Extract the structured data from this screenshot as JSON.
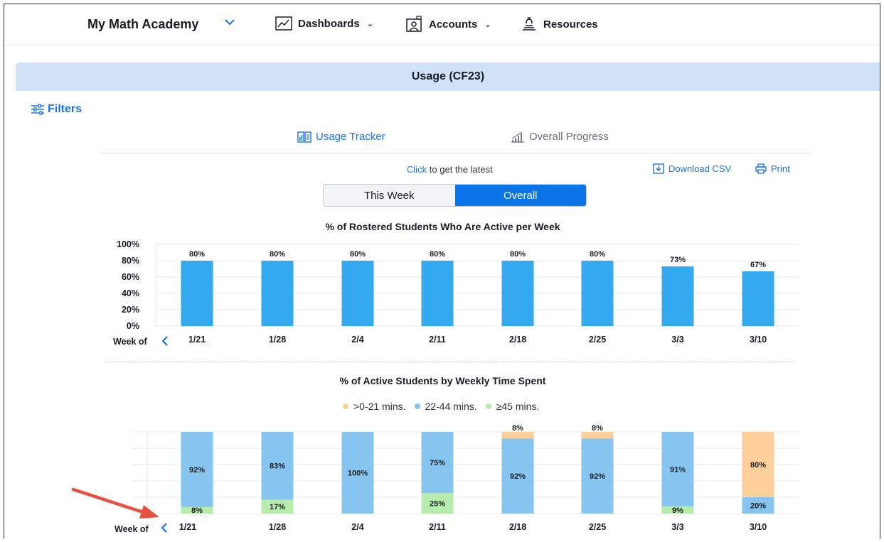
{
  "nav": {
    "brand": "My Math Academy",
    "items": [
      {
        "label": "Dashboards",
        "icon": "line-chart-icon"
      },
      {
        "label": "Accounts",
        "icon": "profile-card-icon"
      },
      {
        "label": "Resources",
        "icon": "books-stack-icon"
      }
    ]
  },
  "panel": {
    "title": "Usage (CF23)",
    "filters_label": "Filters",
    "tabs": [
      {
        "label": "Usage Tracker",
        "active": true
      },
      {
        "label": "Overall Progress",
        "active": false
      }
    ],
    "refresh": {
      "link": "Click",
      "rest": " to get the latest"
    },
    "download_label": "Download CSV",
    "print_label": "Print",
    "toggle": {
      "week": "This Week",
      "overall": "Overall",
      "selected": "Overall"
    },
    "week_of_label": "Week of"
  },
  "colors": {
    "accent": "#1a73e8",
    "bar_active": "#33aaf0",
    "seg_low": "#fdd09a",
    "seg_mid": "#86c5f0",
    "seg_high": "#b8ecad",
    "header_bg": "#cfe2f7"
  },
  "chart_data": [
    {
      "type": "bar",
      "title": "% of Rostered Students Who Are Active per Week",
      "categories": [
        "1/21",
        "1/28",
        "2/4",
        "2/11",
        "2/18",
        "2/25",
        "3/3",
        "3/10"
      ],
      "values": [
        80,
        80,
        80,
        80,
        80,
        80,
        73,
        67
      ],
      "data_labels": [
        "80%",
        "80%",
        "80%",
        "80%",
        "80%",
        "80%",
        "73%",
        "67%"
      ],
      "ylim": [
        0,
        100
      ],
      "yticks": [
        "0%",
        "20%",
        "40%",
        "60%",
        "80%",
        "100%"
      ],
      "xlabel": "Week of",
      "grid": true
    },
    {
      "type": "bar",
      "stacked": true,
      "title": "% of Active Students by Weekly Time Spent",
      "categories": [
        "1/21",
        "1/28",
        "2/4",
        "2/11",
        "2/18",
        "2/25",
        "3/3",
        "3/10"
      ],
      "series": [
        {
          "name": ">0-21 mins.",
          "values": [
            0,
            0,
            0,
            0,
            8,
            8,
            0,
            80
          ]
        },
        {
          "name": "22-44 mins.",
          "values": [
            92,
            83,
            100,
            75,
            92,
            92,
            91,
            20
          ]
        },
        {
          "name": "≥45 mins.",
          "values": [
            8,
            17,
            0,
            25,
            0,
            0,
            9,
            0
          ]
        }
      ],
      "ylim": [
        0,
        100
      ],
      "legend": "top-center",
      "xlabel": "Week of",
      "grid": true
    }
  ]
}
